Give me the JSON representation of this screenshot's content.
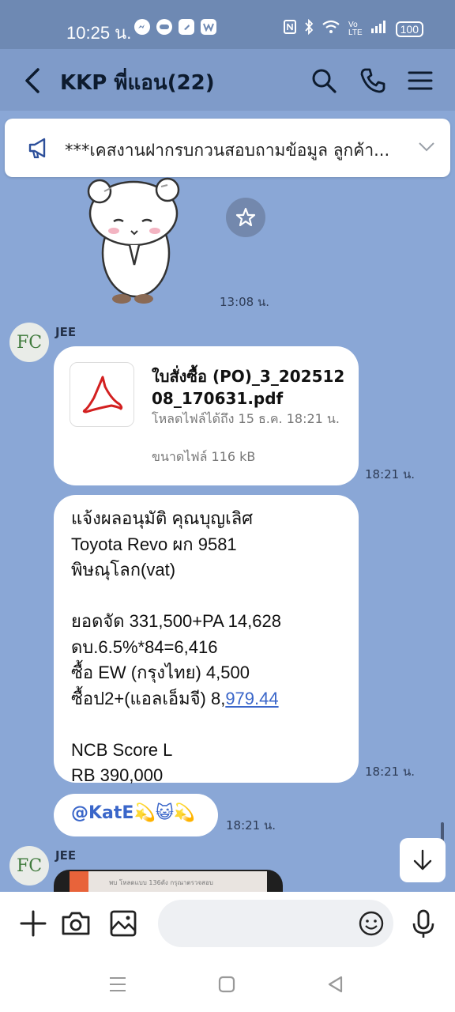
{
  "status_bar": {
    "time": "10:25 น.",
    "battery": "100"
  },
  "header": {
    "title": "KKP พี่แอน(22)"
  },
  "announcement": {
    "text": "***เคสงานฝากรบกวนสอบถามข้อมูล ลูกค้า..."
  },
  "messages": {
    "sticker_time": "13:08 น.",
    "sender1": "JEE",
    "avatar_text": "FC",
    "file": {
      "name": "ใบสั่งซื้อ (PO)_3_20251208_170631.pdf",
      "expiry": "โหลดไฟล์ได้ถึง 15 ธ.ค. 18:21 น.",
      "size": "ขนาดไฟล์ 116 kB",
      "time": "18:21 น."
    },
    "text_msg": {
      "line1": "แจ้งผลอนุมัติ คุณบุญเลิศ",
      "line2": "Toyota Revo ผก 9581",
      "line3": "พิษณุโลก(vat)",
      "line4": "ยอดจัด 331,500+PA 14,628",
      "line5": "ดบ.6.5%*84=6,416",
      "line6": "ซื้อ EW (กรุงไทย) 4,500",
      "line7_prefix": "ซื้อป2+(แอลเอ็มจี) 8,",
      "line7_link": "979.44",
      "line8": "NCB Score L",
      "line9": "RB 390,000",
      "time": "18:21 น."
    },
    "mention": {
      "text": "@KatE💫😺💫",
      "time": "18:21 น."
    },
    "sender2": "JEE",
    "preview_caption": "พบ โหลดแบบ 136ดัง กรุณาตรวจสอบ"
  },
  "input": {
    "placeholder": ""
  },
  "colors": {
    "chat_bg": "#8aa7d6",
    "header_bg": "#7f9bc9",
    "link": "#3a66c9"
  }
}
